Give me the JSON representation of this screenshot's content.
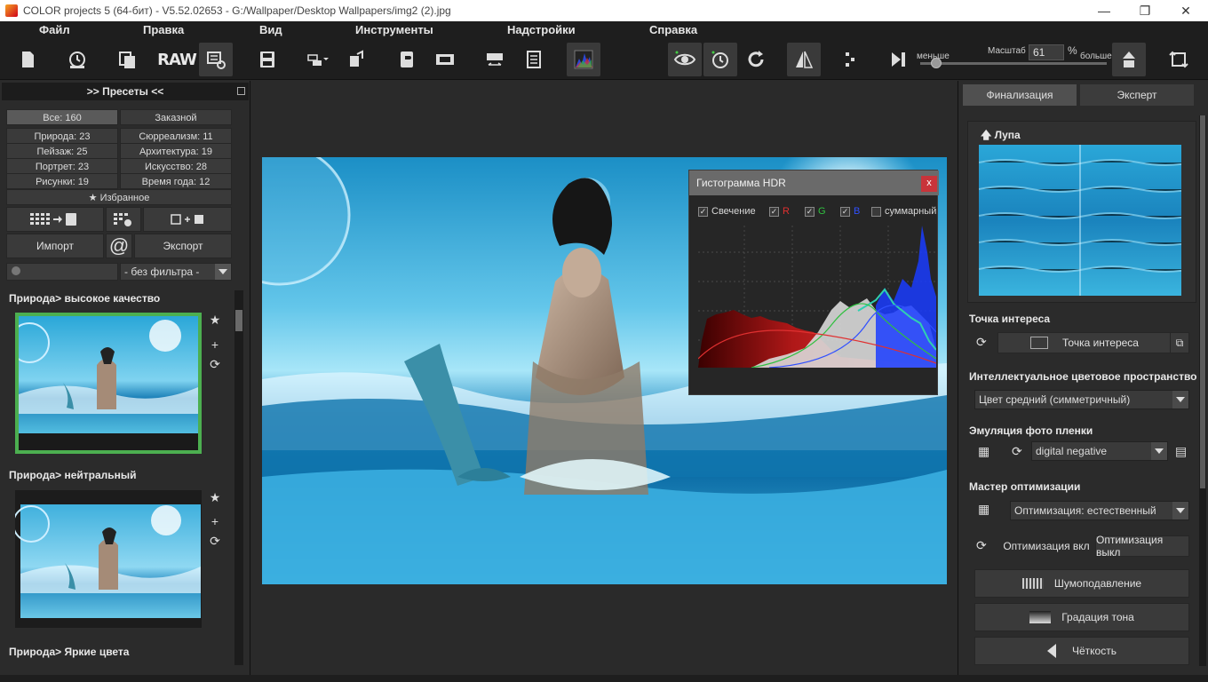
{
  "window": {
    "title": "COLOR projects 5 (64-бит) - V5.52.02653 - G:/Wallpaper/Desktop Wallpapers/img2 (2).jpg",
    "min_glyph": "—",
    "max_glyph": "❐",
    "close_glyph": "✕"
  },
  "menu": {
    "items": [
      "Файл",
      "Правка",
      "Вид",
      "Инструменты",
      "Надстройки",
      "Справка"
    ]
  },
  "toolbar": {
    "raw_label": "RAW",
    "zoom_label": "Масштаб",
    "zoom_value": "61",
    "zoom_unit": "%",
    "less_label": "меньше",
    "more_label": "больше",
    "icons": [
      "new-document-icon",
      "history-icon",
      "batch-icon",
      "raw-icon",
      "settings-grid-icon",
      "save-icon",
      "export-menu-icon",
      "copy-export-icon",
      "print-icon",
      "film-icon",
      "compare-icon",
      "panel-icon",
      "histogram-icon",
      "preview-eye-icon",
      "timer-icon",
      "redo-icon",
      "mirror-icon",
      "split-view-icon",
      "magnifier-icon",
      "crop-icon",
      "rotate-icon"
    ]
  },
  "presets": {
    "header": ">> Пресеты <<",
    "categories": [
      {
        "label": "Все: 160",
        "selected": true
      },
      {
        "label": "Заказной",
        "selected": false
      },
      {
        "label": "Природа: 23",
        "selected": false
      },
      {
        "label": "Сюрреализм: 11",
        "selected": false
      },
      {
        "label": "Пейзаж: 25",
        "selected": false
      },
      {
        "label": "Архитектура: 19",
        "selected": false
      },
      {
        "label": "Портрет: 23",
        "selected": false
      },
      {
        "label": "Искусство: 28",
        "selected": false
      },
      {
        "label": "Рисунки: 19",
        "selected": false
      },
      {
        "label": "Время года: 12",
        "selected": false
      }
    ],
    "favorites": "Избранное",
    "import_label": "Импорт",
    "export_label": "Экспорт",
    "filter_value": "- без фильтра -",
    "items": [
      {
        "title": "Природа> высокое качество"
      },
      {
        "title": "Природа> нейтральный"
      },
      {
        "title": "Природа> Яркие цвета"
      }
    ]
  },
  "histogram": {
    "title": "Гистограмма HDR",
    "close": "x",
    "checks": [
      {
        "label": "Свечение",
        "checked": true,
        "color": "#e0e0e0"
      },
      {
        "label": "R",
        "checked": true,
        "color": "#e03030"
      },
      {
        "label": "G",
        "checked": true,
        "color": "#30c040"
      },
      {
        "label": "B",
        "checked": true,
        "color": "#3050ff"
      },
      {
        "label": "суммарный",
        "checked": false,
        "color": "#e0e0e0"
      }
    ]
  },
  "right": {
    "tabs": [
      {
        "label": "Финализация",
        "selected": true
      },
      {
        "label": "Эксперт",
        "selected": false
      }
    ],
    "loupe_title": "Лупа",
    "interest_title": "Точка интереса",
    "interest_button": "Точка интереса",
    "colorspace_title": "Интеллектуальное цветовое пространство",
    "colorspace_value": "Цвет средний (симметричный)",
    "film_title": "Эмуляция фото пленки",
    "film_value": "digital negative",
    "optimize_title": "Мастер оптимизации",
    "optimize_value": "Оптимизация: естественный",
    "opt_on": "Оптимизация вкл",
    "opt_off": "Оптимизация выкл",
    "noise": "Шумоподавление",
    "tone": "Градация тона",
    "sharp": "Чёткость"
  }
}
